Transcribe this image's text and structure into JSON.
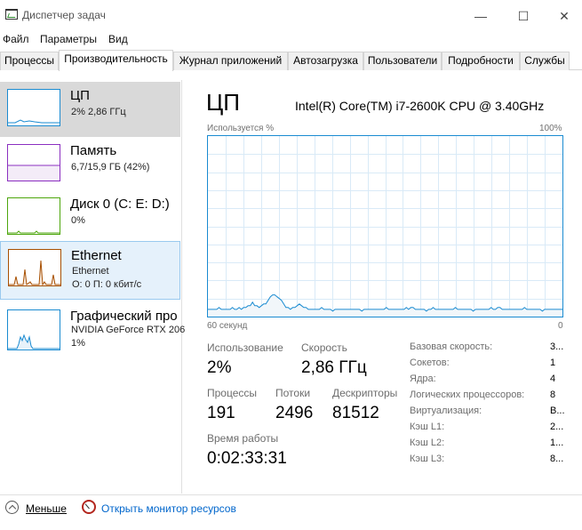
{
  "window": {
    "title": "Диспетчер задач",
    "minimize_glyph": "—",
    "maximize_glyph": "☐",
    "close_glyph": "✕"
  },
  "menu": [
    "Файл",
    "Параметры",
    "Вид"
  ],
  "tabs": [
    {
      "label": "Процессы",
      "active": false
    },
    {
      "label": "Производительность",
      "active": true
    },
    {
      "label": "Журнал приложений",
      "active": false
    },
    {
      "label": "Автозагрузка",
      "active": false
    },
    {
      "label": "Пользователи",
      "active": false
    },
    {
      "label": "Подробности",
      "active": false
    },
    {
      "label": "Службы",
      "active": false
    }
  ],
  "sidebar": {
    "items": [
      {
        "title": "ЦП",
        "line1": "2% 2,86 ГГц",
        "line2": "",
        "color": "#1a8bd1",
        "state": "selected"
      },
      {
        "title": "Память",
        "line1": "6,7/15,9 ГБ (42%)",
        "line2": "",
        "color": "#8b2fc0",
        "state": "normal"
      },
      {
        "title": "Диск 0 (C: E: D:)",
        "line1": "0%",
        "line2": "",
        "color": "#4da60c",
        "state": "normal"
      },
      {
        "title": "Ethernet",
        "line1": "Ethernet",
        "line2": "О: 0 П: 0 кбит/с",
        "color": "#a74f01",
        "state": "hover"
      },
      {
        "title": "Графический про",
        "line1": "NVIDIA GeForce RTX 206",
        "line2": "1%",
        "color": "#1a8bd1",
        "state": "normal"
      }
    ]
  },
  "main": {
    "title": "ЦП",
    "cpu_name": "Intel(R) Core(TM) i7-2600K CPU @ 3.40GHz",
    "graph": {
      "top_left_label": "Используется %",
      "top_right_label": "100%",
      "bottom_left_label": "60 секунд",
      "bottom_right_label": "0",
      "line_color": "#1a8bd1",
      "fill_color": "#f1f6fa",
      "grid_color": "#d9eaf7",
      "series": [
        4,
        4,
        4,
        4,
        4,
        5,
        4,
        4,
        4,
        4,
        4,
        5,
        4,
        4,
        5,
        4,
        5,
        5,
        6,
        6,
        8,
        6,
        6,
        5,
        6,
        7,
        7,
        9,
        11,
        12,
        12,
        11,
        10,
        9,
        7,
        5,
        5,
        4,
        5,
        5,
        6,
        7,
        6,
        5,
        5,
        4,
        4,
        4,
        4,
        4,
        4,
        5,
        4,
        4,
        4,
        4,
        3,
        4,
        4,
        4,
        4,
        4,
        4,
        4,
        4,
        4,
        4,
        4,
        4,
        3,
        4,
        4,
        4,
        4,
        4,
        4,
        4,
        4,
        4,
        4,
        5,
        4,
        4,
        4,
        4,
        4,
        4,
        4,
        4,
        5,
        4,
        5,
        5,
        4,
        4,
        4,
        4,
        4,
        3,
        4,
        4,
        5,
        4,
        4,
        4,
        4,
        4,
        4,
        4,
        4,
        4,
        5,
        4,
        4,
        4,
        4,
        4,
        4,
        4,
        3,
        4,
        4,
        4,
        4,
        4,
        4,
        4,
        5,
        4,
        4,
        5,
        5,
        4,
        4,
        4,
        4,
        4,
        4,
        4,
        4,
        4,
        4,
        5,
        4,
        4,
        4,
        4,
        4,
        4,
        4,
        3,
        4,
        4,
        4,
        4,
        4,
        4,
        4,
        4,
        4
      ]
    },
    "stats": {
      "usage_label": "Использование",
      "usage_value": "2%",
      "speed_label": "Скорость",
      "speed_value": "2,86 ГГц",
      "processes_label": "Процессы",
      "processes_value": "191",
      "threads_label": "Потоки",
      "threads_value": "2496",
      "handles_label": "Дескрипторы",
      "handles_value": "81512",
      "uptime_label": "Время работы",
      "uptime_value": "0:02:33:31"
    },
    "info": [
      {
        "label": "Базовая скорость:",
        "value": "3..."
      },
      {
        "label": "Сокетов:",
        "value": "1"
      },
      {
        "label": "Ядра:",
        "value": "4"
      },
      {
        "label": "Логических процессоров:",
        "value": "8"
      },
      {
        "label": "Виртуализация:",
        "value": "В..."
      },
      {
        "label": "Кэш L1:",
        "value": "2..."
      },
      {
        "label": "Кэш L2:",
        "value": "1..."
      },
      {
        "label": "Кэш L3:",
        "value": "8..."
      }
    ]
  },
  "footer": {
    "less_label": "Меньше",
    "monitor_label": "Открыть монитор ресурсов"
  }
}
